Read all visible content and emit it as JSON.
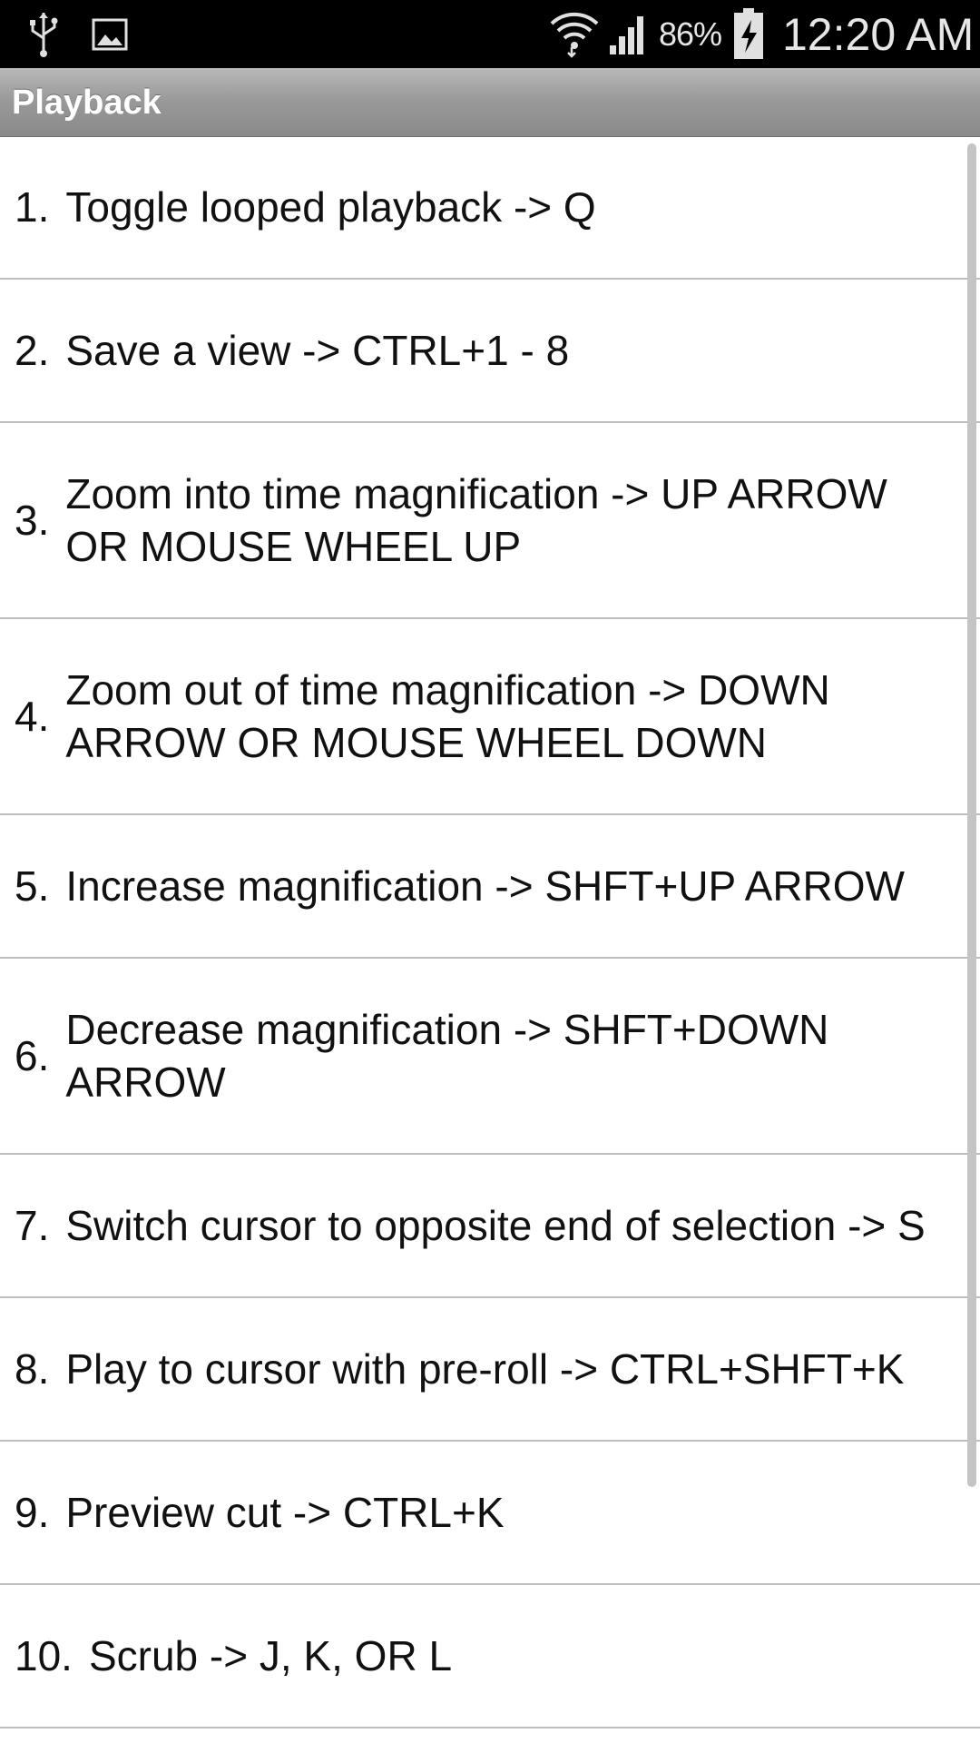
{
  "status_bar": {
    "battery_percent": "86%",
    "time": "12:20 AM",
    "icons": [
      "usb-icon",
      "image-icon",
      "wifi-icon",
      "signal-icon",
      "battery-charging-icon"
    ]
  },
  "title_bar": {
    "title": "Playback"
  },
  "list": {
    "items": [
      {
        "number": "1.",
        "text": "Toggle looped playback -> Q"
      },
      {
        "number": "2.",
        "text": "Save a view -> CTRL+1 - 8"
      },
      {
        "number": "3.",
        "text": "Zoom into time magnification -> UP ARROW OR MOUSE WHEEL UP"
      },
      {
        "number": "4.",
        "text": "Zoom out of time magnification -> DOWN ARROW OR MOUSE WHEEL DOWN"
      },
      {
        "number": "5.",
        "text": "Increase magnification -> SHFT+UP ARROW"
      },
      {
        "number": "6.",
        "text": "Decrease magnification -> SHFT+DOWN ARROW"
      },
      {
        "number": "7.",
        "text": "Switch cursor to opposite end of selection -> S"
      },
      {
        "number": "8.",
        "text": "Play to cursor with pre-roll -> CTRL+SHFT+K"
      },
      {
        "number": "9.",
        "text": "Preview cut -> CTRL+K"
      },
      {
        "number": "10.",
        "text": "Scrub -> J, K, OR L"
      }
    ]
  },
  "colors": {
    "status_bar_bg": "#000000",
    "title_bar_bg": "#9a9a9a",
    "divider": "#bdbdbd",
    "text": "#111111"
  }
}
